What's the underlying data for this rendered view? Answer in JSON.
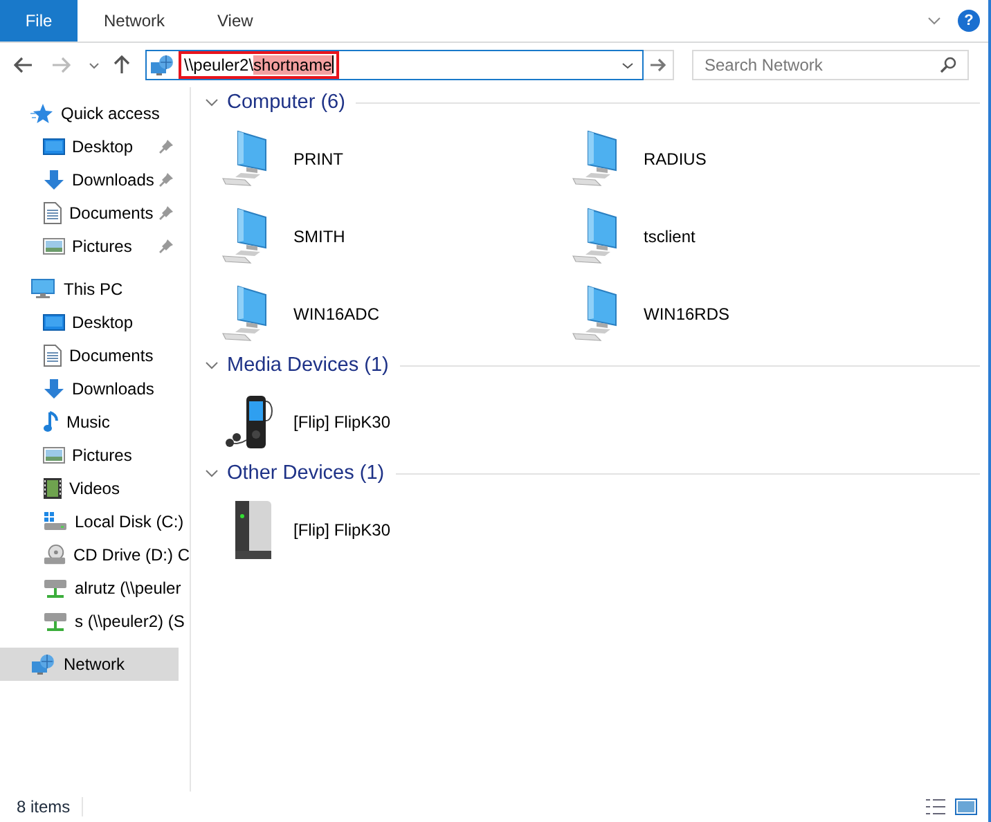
{
  "ribbon": {
    "tabs": [
      {
        "label": "File",
        "kind": "menu"
      },
      {
        "label": "Network",
        "kind": "tab"
      },
      {
        "label": "View",
        "kind": "tab"
      }
    ],
    "help": "?"
  },
  "address": {
    "prefix": "\\\\peuler2\\",
    "selected_text": "shortname",
    "highlighted": true
  },
  "search": {
    "placeholder": "Search Network"
  },
  "sidebar": {
    "items": [
      {
        "label": "Quick access",
        "kind": "star",
        "selected": false,
        "children": [
          {
            "label": "Desktop",
            "kind": "desktop",
            "pinned": true,
            "selected": false
          },
          {
            "label": "Downloads",
            "kind": "downloads",
            "pinned": true,
            "selected": false
          },
          {
            "label": "Documents",
            "kind": "documents",
            "pinned": true,
            "selected": false
          },
          {
            "label": "Pictures",
            "kind": "pictures",
            "pinned": true,
            "selected": false
          }
        ]
      },
      {
        "label": "This PC",
        "kind": "pc",
        "selected": false,
        "children": [
          {
            "label": "Desktop",
            "kind": "desktop",
            "selected": false
          },
          {
            "label": "Documents",
            "kind": "documents",
            "selected": false
          },
          {
            "label": "Downloads",
            "kind": "downloads",
            "selected": false
          },
          {
            "label": "Music",
            "kind": "music",
            "selected": false
          },
          {
            "label": "Pictures",
            "kind": "pictures",
            "selected": false
          },
          {
            "label": "Videos",
            "kind": "videos",
            "selected": false
          },
          {
            "label": "Local Disk (C:)",
            "kind": "disk",
            "selected": false
          },
          {
            "label": "CD Drive (D:) C",
            "kind": "cd",
            "selected": false
          },
          {
            "label": "alrutz (\\\\peuler",
            "kind": "netdrive",
            "selected": false
          },
          {
            "label": "s (\\\\peuler2) (S",
            "kind": "netdrive",
            "selected": false
          }
        ]
      },
      {
        "label": "Network",
        "kind": "network",
        "selected": true
      }
    ]
  },
  "groups": [
    {
      "title": "Computer (6)",
      "items": [
        {
          "name": "PRINT",
          "kind": "computer"
        },
        {
          "name": "RADIUS",
          "kind": "computer"
        },
        {
          "name": "SMITH",
          "kind": "computer"
        },
        {
          "name": "tsclient",
          "kind": "computer"
        },
        {
          "name": "WIN16ADC",
          "kind": "computer"
        },
        {
          "name": "WIN16RDS",
          "kind": "computer"
        }
      ]
    },
    {
      "title": "Media Devices (1)",
      "items": [
        {
          "name": "[Flip] FlipK30",
          "kind": "player"
        }
      ]
    },
    {
      "title": "Other Devices (1)",
      "items": [
        {
          "name": "[Flip] FlipK30",
          "kind": "device"
        }
      ]
    }
  ],
  "status_bar": {
    "count": "8 items"
  }
}
